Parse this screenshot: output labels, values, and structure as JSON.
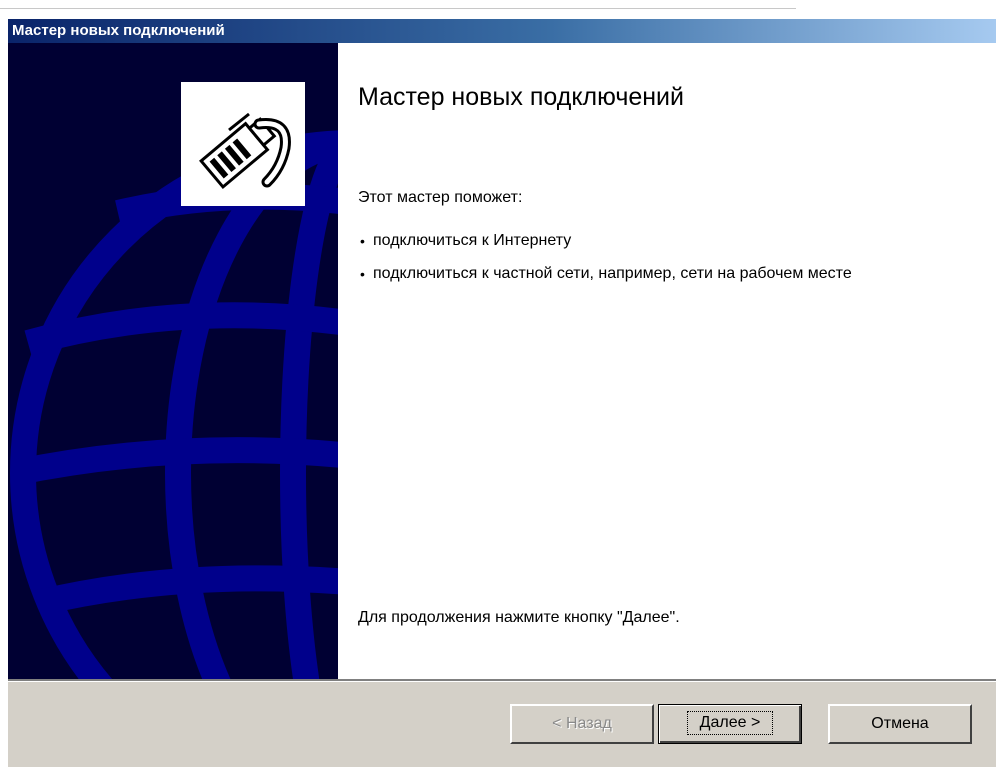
{
  "window": {
    "title": "Мастер новых подключений"
  },
  "side_panel": {
    "logo_icon": "network-cable-plug-icon",
    "background_color": "#000033",
    "globe_color": "#00008b"
  },
  "main": {
    "heading": "Мастер новых подключений",
    "intro": "Этот мастер поможет:",
    "bullets": [
      "подключиться к Интернету",
      "подключиться к частной сети, например, сети на рабочем месте"
    ],
    "footnote": "Для продолжения нажмите кнопку \"Далее\"."
  },
  "buttons": {
    "back_label": "< Назад",
    "next_label": "Далее >",
    "cancel_label": "Отмена",
    "back_enabled": false
  },
  "colors": {
    "titlebar_start": "#0a246a",
    "titlebar_end": "#a6caf0",
    "button_face": "#d4d0c8"
  }
}
